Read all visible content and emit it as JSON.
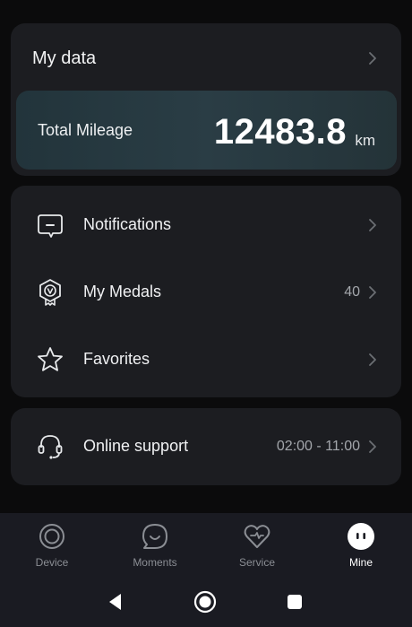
{
  "my_data": {
    "title": "My data",
    "mileage_label": "Total Mileage",
    "mileage_value": "12483.8",
    "mileage_unit": "km"
  },
  "menu": {
    "items": [
      {
        "label": "Notifications",
        "icon": "message-icon",
        "meta": ""
      },
      {
        "label": "My Medals",
        "icon": "medal-icon",
        "meta": "40"
      },
      {
        "label": "Favorites",
        "icon": "star-icon",
        "meta": ""
      }
    ]
  },
  "support": {
    "label": "Online support",
    "icon": "headset-icon",
    "hours": "02:00 - 11:00"
  },
  "tabs": [
    {
      "label": "Device",
      "icon": "device-icon"
    },
    {
      "label": "Moments",
      "icon": "moments-icon"
    },
    {
      "label": "Service",
      "icon": "heart-icon"
    },
    {
      "label": "Mine",
      "icon": "profile-face-icon",
      "active": true
    }
  ],
  "colors": {
    "background": "#0b0b0c",
    "card": "#1c1d21",
    "mileage_card": "#2a3d45",
    "tabbar": "#1a1b22",
    "muted_text": "#a3a6ab"
  }
}
